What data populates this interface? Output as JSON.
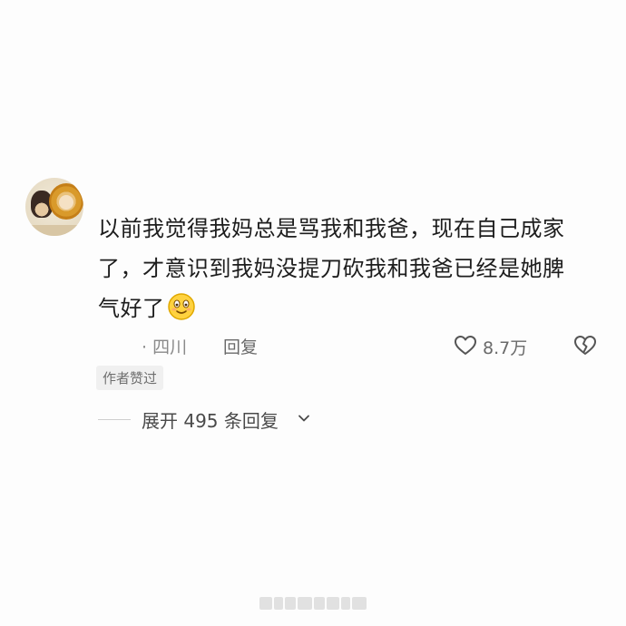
{
  "comment": {
    "text_lines": [
      "以前我觉得我妈总是骂我和我爸，现在自己成家",
      "了，才意识到我妈没提刀砍我和我爸已经是她脾",
      "气好了"
    ],
    "emoji": "smiling-face-emoji"
  },
  "meta": {
    "location": "· 四川",
    "reply_label": "回复",
    "like_count": "8.7万"
  },
  "badge": {
    "label": "作者赞过"
  },
  "replies": {
    "expand_label": "展开 495 条回复"
  },
  "icons": {
    "like": "heart-outline-icon",
    "dislike": "broken-heart-icon",
    "expand": "chevron-down-icon"
  },
  "colors": {
    "text_primary": "#1d1d1d",
    "text_secondary": "#8a8a8a",
    "badge_bg": "#f0f0f0",
    "emoji_yellow": "#ffd23f"
  }
}
